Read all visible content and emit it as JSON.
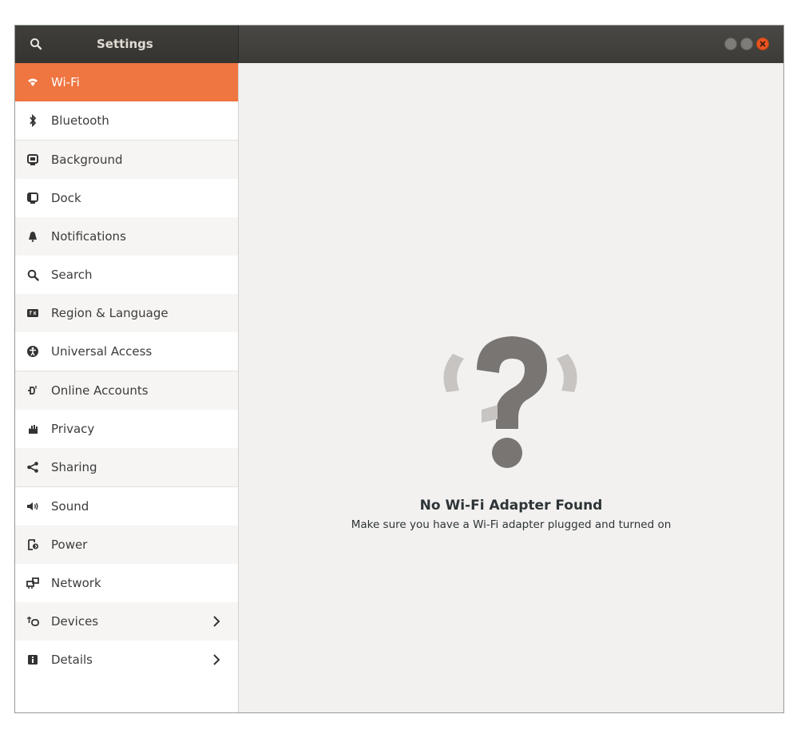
{
  "window": {
    "title": "Settings",
    "controls": [
      "minimize-icon",
      "maximize-icon",
      "close-icon"
    ],
    "accent_color": "#ef7541"
  },
  "sidebar": {
    "items": [
      {
        "label": "Wi-Fi",
        "icon": "wifi-icon",
        "selected": true
      },
      {
        "label": "Bluetooth",
        "icon": "bluetooth-icon"
      },
      {
        "label": "Background",
        "icon": "background-icon"
      },
      {
        "label": "Dock",
        "icon": "dock-icon"
      },
      {
        "label": "Notifications",
        "icon": "bell-icon"
      },
      {
        "label": "Search",
        "icon": "search-icon"
      },
      {
        "label": "Region & Language",
        "icon": "region-icon"
      },
      {
        "label": "Universal Access",
        "icon": "accessibility-icon"
      },
      {
        "label": "Online Accounts",
        "icon": "online-accounts-icon"
      },
      {
        "label": "Privacy",
        "icon": "privacy-hand-icon"
      },
      {
        "label": "Sharing",
        "icon": "share-icon"
      },
      {
        "label": "Sound",
        "icon": "speaker-icon"
      },
      {
        "label": "Power",
        "icon": "power-icon"
      },
      {
        "label": "Network",
        "icon": "network-icon"
      },
      {
        "label": "Devices",
        "icon": "devices-icon",
        "has_submenu": true
      },
      {
        "label": "Details",
        "icon": "details-icon",
        "has_submenu": true
      }
    ]
  },
  "main": {
    "empty_state_icon": "question-mark-icon",
    "title": "No Wi-Fi Adapter Found",
    "subtitle": "Make sure you have a Wi-Fi adapter plugged and turned on"
  }
}
